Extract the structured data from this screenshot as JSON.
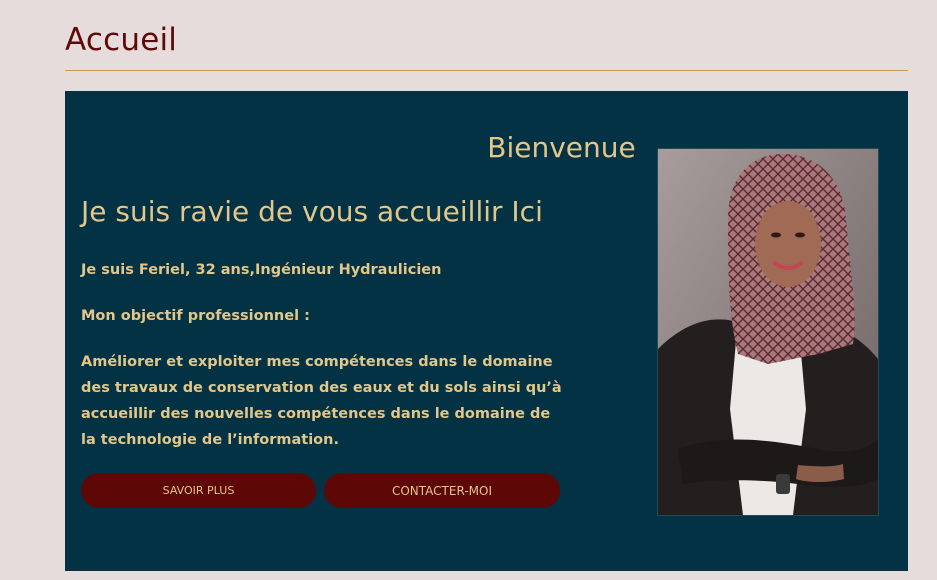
{
  "page": {
    "title": "Accueil"
  },
  "hero": {
    "heading": "Bienvenue",
    "subheading": "Je suis ravie de vous accueillir Ici",
    "intro": "Je suis Feriel, 32 ans,Ingénieur Hydraulicien",
    "objective_label": "Mon objectif professionnel :",
    "objective_text": "Améliorer et exploiter mes compétences dans le domaine des travaux de conservation des eaux et du sols ainsi qu’à accueillir des nouvelles compétences dans le domaine de la technologie de l’information.",
    "buttons": {
      "more": "SAVOIR PLUS",
      "contact": "CONTACTER-MOI"
    },
    "photo_icon": "profile-photo"
  },
  "colors": {
    "background": "#e7dcdc",
    "title": "#5e0a08",
    "rule": "#c79c54",
    "hero_bg": "#023244",
    "accent_text": "#e3c689",
    "button_bg": "#5e0707"
  }
}
